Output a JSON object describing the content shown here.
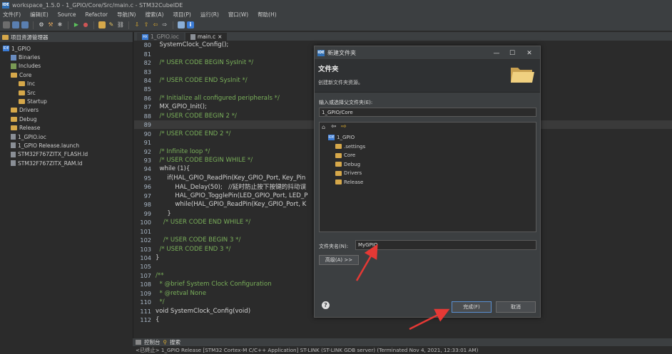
{
  "window": {
    "title": "workspace_1.5.0 - 1_GPIO/Core/Src/main.c - STM32CubeIDE",
    "app_icon": "IDE"
  },
  "menu": [
    "文件(F)",
    "编辑(E)",
    "Source",
    "Refactor",
    "导航(N)",
    "搜索(A)",
    "项目(P)",
    "运行(R)",
    "窗口(W)",
    "帮助(H)"
  ],
  "toolbar": {
    "icons": [
      "new-icon",
      "save-icon",
      "save-all-icon",
      "settings-icon",
      "build-icon",
      "debug-icon",
      "run-icon",
      "external-tools-icon",
      "open-icon",
      "pen-icon",
      "link-icon",
      "next-annotation-icon",
      "prev-annotation-icon",
      "back-icon",
      "forward-icon",
      "task-icon",
      "info-icon"
    ]
  },
  "left_panel": {
    "tab_label": "项目资源管理器",
    "tree": [
      {
        "label": "1_GPIO",
        "icon": "project-icon",
        "level": 0
      },
      {
        "label": "Binaries",
        "icon": "binaries-icon",
        "level": 1
      },
      {
        "label": "Includes",
        "icon": "includes-icon",
        "level": 1
      },
      {
        "label": "Core",
        "icon": "folder-icon",
        "level": 1
      },
      {
        "label": "Inc",
        "icon": "folder-icon",
        "level": 2
      },
      {
        "label": "Src",
        "icon": "folder-icon",
        "level": 2
      },
      {
        "label": "Startup",
        "icon": "folder-icon",
        "level": 2
      },
      {
        "label": "Drivers",
        "icon": "folder-icon",
        "level": 1
      },
      {
        "label": "Debug",
        "icon": "folder-icon",
        "level": 1
      },
      {
        "label": "Release",
        "icon": "folder-icon",
        "level": 1
      },
      {
        "label": "1_GPIO.ioc",
        "icon": "file-icon",
        "level": 1
      },
      {
        "label": "1_GPIO Release.launch",
        "icon": "file-icon",
        "level": 1
      },
      {
        "label": "STM32F767ZITX_FLASH.ld",
        "icon": "file-icon",
        "level": 1
      },
      {
        "label": "STM32F767ZITX_RAM.ld",
        "icon": "file-icon",
        "level": 1
      }
    ]
  },
  "editor": {
    "tabs": [
      {
        "label": "1_GPIO.ioc"
      },
      {
        "label": "main.c",
        "close": "×"
      }
    ],
    "lines": [
      {
        "n": "80",
        "t": "  SystemClock_Config();",
        "c": "code"
      },
      {
        "n": "81",
        "t": "",
        "c": "code"
      },
      {
        "n": "82",
        "t": "  /* USER CODE BEGIN SysInit */",
        "c": "cm"
      },
      {
        "n": "83",
        "t": "",
        "c": "code"
      },
      {
        "n": "84",
        "t": "  /* USER CODE END SysInit */",
        "c": "cm"
      },
      {
        "n": "85",
        "t": "",
        "c": "code"
      },
      {
        "n": "86",
        "t": "  /* Initialize all configured peripherals */",
        "c": "cm"
      },
      {
        "n": "87",
        "t": "  MX_GPIO_Init();",
        "c": "code"
      },
      {
        "n": "88",
        "t": "  /* USER CODE BEGIN 2 */",
        "c": "cm"
      },
      {
        "n": "89",
        "t": "",
        "c": "code"
      },
      {
        "n": "90",
        "t": "  /* USER CODE END 2 */",
        "c": "cm"
      },
      {
        "n": "91",
        "t": "",
        "c": "code"
      },
      {
        "n": "92",
        "t": "  /* Infinite loop */",
        "c": "cm"
      },
      {
        "n": "93",
        "t": "  /* USER CODE BEGIN WHILE */",
        "c": "cm"
      },
      {
        "n": "94",
        "t": "  while (1){",
        "c": "kw"
      },
      {
        "n": "95",
        "t": "      if(HAL_GPIO_ReadPin(Key_GPIO_Port, Key_Pin",
        "c": "code"
      },
      {
        "n": "96",
        "t": "          HAL_Delay(50);   //延时防止按下按键的抖动误",
        "c": "code"
      },
      {
        "n": "97",
        "t": "          HAL_GPIO_TogglePin(LED_GPIO_Port, LED_P",
        "c": "code"
      },
      {
        "n": "98",
        "t": "          while(HAL_GPIO_ReadPin(Key_GPIO_Port, K",
        "c": "code"
      },
      {
        "n": "99",
        "t": "      }",
        "c": "code"
      },
      {
        "n": "100",
        "t": "    /* USER CODE END WHILE */",
        "c": "cm"
      },
      {
        "n": "101",
        "t": "",
        "c": "code"
      },
      {
        "n": "102",
        "t": "    /* USER CODE BEGIN 3 */",
        "c": "cm"
      },
      {
        "n": "103",
        "t": "  /* USER CODE END 3 */",
        "c": "cm"
      },
      {
        "n": "104",
        "t": "}",
        "c": "code"
      },
      {
        "n": "105",
        "t": "",
        "c": "code"
      },
      {
        "n": "107",
        "t": "/**",
        "c": "cm"
      },
      {
        "n": "108",
        "t": "  * @brief System Clock Configuration",
        "c": "cm"
      },
      {
        "n": "109",
        "t": "  * @retval None",
        "c": "cm"
      },
      {
        "n": "110",
        "t": "  */",
        "c": "cm"
      },
      {
        "n": "111",
        "t": "void SystemClock_Config(void)",
        "c": "code"
      },
      {
        "n": "112",
        "t": "{",
        "c": "code"
      }
    ]
  },
  "bottom": {
    "tabs": [
      "控制台",
      "搜索"
    ],
    "status": "<已终止> 1_GPIO Release [STM32 Cortex-M C/C++ Application] ST-LINK (ST-LINK GDB server) (Terminated Nov 4, 2021, 12:33:01 AM)"
  },
  "dialog": {
    "title": "新建文件夹",
    "heading": "文件夹",
    "subtitle": "创建新文件夹资源。",
    "parent_label": "输入或选择父文件夹(E):",
    "parent_value": "1_GPIO/Core",
    "tree": [
      {
        "label": "1_GPIO",
        "icon": "project-icon"
      },
      {
        "label": ".settings",
        "icon": "folder-icon"
      },
      {
        "label": "Core",
        "icon": "folder-icon"
      },
      {
        "label": "Debug",
        "icon": "folder-icon"
      },
      {
        "label": "Drivers",
        "icon": "folder-icon"
      },
      {
        "label": "Release",
        "icon": "folder-icon"
      }
    ],
    "name_label": "文件夹名(N):",
    "name_value": "MyGPIO",
    "advanced_label": "高级(A) >>",
    "finish_label": "完成(F)",
    "cancel_label": "取消",
    "help_icon": "?"
  }
}
